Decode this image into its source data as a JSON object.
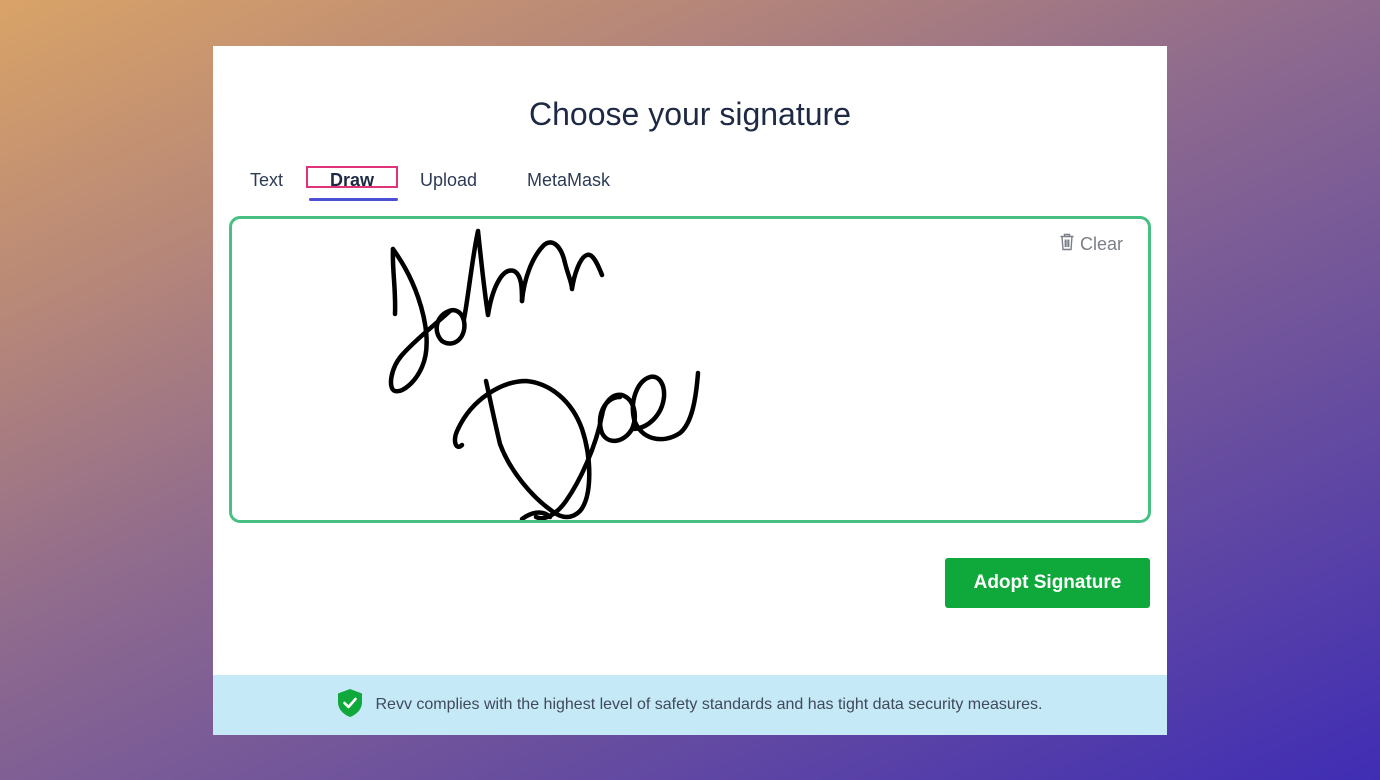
{
  "dialog": {
    "title": "Choose your signature"
  },
  "tabs": [
    {
      "label": "Text"
    },
    {
      "label": "Draw",
      "active": true
    },
    {
      "label": "Upload"
    },
    {
      "label": "MetaMask"
    }
  ],
  "canvas": {
    "clear_label": "Clear",
    "clear_icon": "trash-icon",
    "signature_text": "John Doe"
  },
  "actions": {
    "adopt_label": "Adopt Signature"
  },
  "footer": {
    "icon": "shield-check-icon",
    "text": "Revv complies with the highest level of safety standards and has tight data security measures."
  },
  "colors": {
    "accent_green": "#0fa83a",
    "canvas_border": "#48c083",
    "tab_underline": "#4a4fd6",
    "highlight_box": "#e2337a",
    "footer_bg": "#c5e9f7"
  }
}
